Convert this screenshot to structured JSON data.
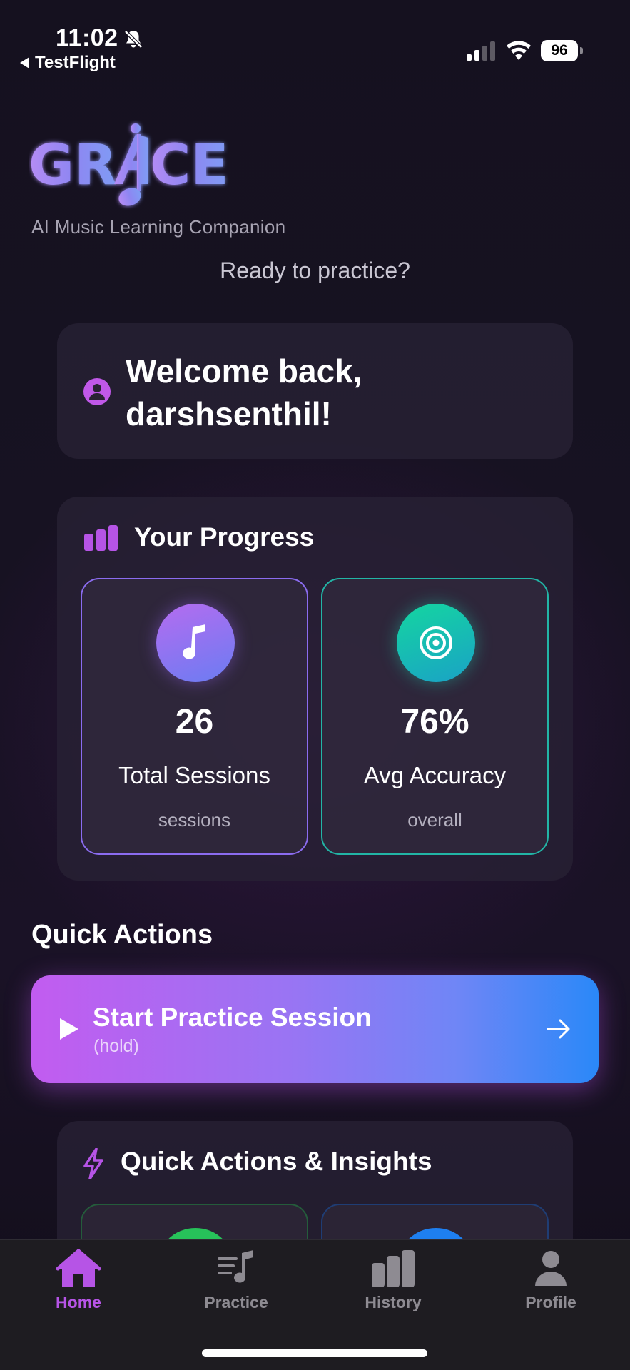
{
  "status_bar": {
    "time": "11:02",
    "back_app": "TestFlight",
    "battery": "96",
    "icons": [
      "bell-slash-icon",
      "signal-icon",
      "wifi-icon",
      "battery-icon"
    ]
  },
  "brand": {
    "logo_text": "GRAICE",
    "tagline": "AI Music Learning Companion"
  },
  "header": {
    "subtitle": "Ready to practice?"
  },
  "welcome": {
    "text": "Welcome back, darshsenthil!"
  },
  "progress": {
    "title": "Your Progress",
    "stats": [
      {
        "value": "26",
        "label": "Total Sessions",
        "sub": "sessions",
        "icon": "music-note-icon",
        "accent": "#8b6cf0"
      },
      {
        "value": "76%",
        "label": "Avg Accuracy",
        "sub": "overall",
        "icon": "target-icon",
        "accent": "#22b5a6"
      }
    ]
  },
  "quick_actions": {
    "heading": "Quick Actions",
    "start_button": {
      "label": "Start Practice Session",
      "hint": "(hold)"
    }
  },
  "insights": {
    "title": "Quick Actions & Insights"
  },
  "tabs": [
    {
      "label": "Home",
      "icon": "home-icon",
      "active": true
    },
    {
      "label": "Practice",
      "icon": "practice-icon",
      "active": false
    },
    {
      "label": "History",
      "icon": "history-chart-icon",
      "active": false
    },
    {
      "label": "Profile",
      "icon": "profile-icon",
      "active": false
    }
  ],
  "colors": {
    "accent_purple": "#b654e6",
    "gradient_start": "#c25cf0",
    "gradient_end": "#2a88f8",
    "teal": "#22b5a6",
    "background": "#15111f"
  }
}
